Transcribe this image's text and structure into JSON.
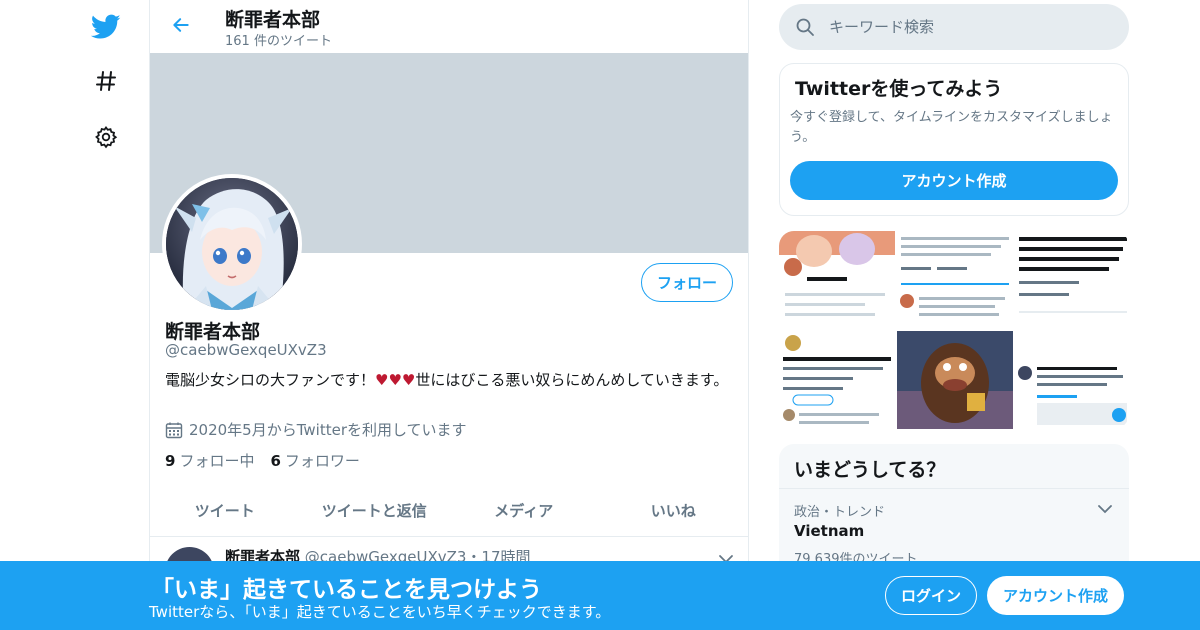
{
  "colors": {
    "accent": "#1da1f2",
    "banner": "#ccd6dd",
    "secondary_text": "#657786",
    "heart": "#be1931"
  },
  "nav": {
    "items": [
      {
        "icon": "twitter-bird-icon"
      },
      {
        "icon": "hashtag-icon"
      },
      {
        "icon": "gear-icon"
      }
    ]
  },
  "header": {
    "title": "断罪者本部",
    "tweet_count": "161 件のツイート"
  },
  "profile": {
    "name": "断罪者本部",
    "handle": "@caebwGexqeUXvZ3",
    "bio_before": "電脳少女シロの大ファンです！",
    "bio_hearts": "♥♥♥",
    "bio_after": "世にはびこる悪い奴らにめんめしていきます。",
    "joined": "2020年5月からTwitterを利用しています",
    "following_count": "9",
    "following_label": "フォロー中",
    "followers_count": "6",
    "followers_label": "フォロワー",
    "follow_button": "フォロー"
  },
  "tabs": [
    "ツイート",
    "ツイートと返信",
    "メディア",
    "いいね"
  ],
  "tweet": {
    "name": "断罪者本部",
    "meta": "@caebwGexqeUXvZ3・17時間"
  },
  "search": {
    "placeholder": "キーワード検索"
  },
  "signup_card": {
    "title": "Twitterを使ってみよう",
    "description": "今すぐ登録して、タイムラインをカスタマイズしましょう。",
    "button": "アカウント作成"
  },
  "trends": {
    "title": "いまどうしてる？",
    "items": [
      {
        "category": "政治・トレンド",
        "name": "Vietnam",
        "count": "79,639件のツイート"
      }
    ]
  },
  "bottom_bar": {
    "title": "「いま」起きていることを見つけよう",
    "subtitle": "Twitterなら、「いま」起きていることをいち早くチェックできます。",
    "login": "ログイン",
    "signup": "アカウント作成"
  }
}
